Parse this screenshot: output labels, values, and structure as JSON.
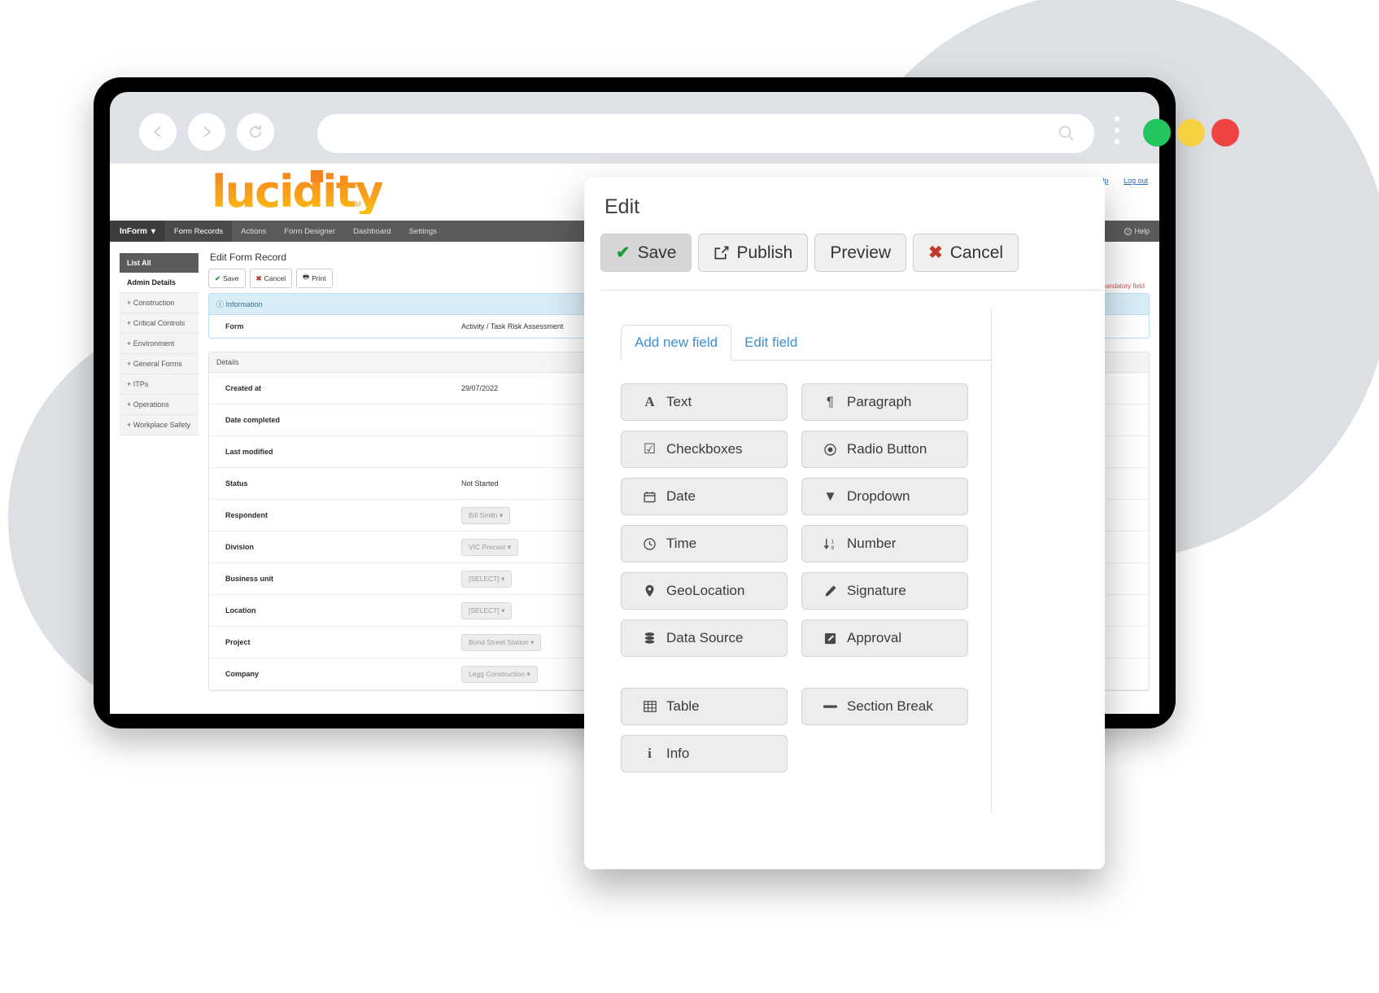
{
  "browser": {
    "back_icon": "chevron-left",
    "forward_icon": "chevron-right",
    "reload_icon": "reload",
    "omnibox_value": "",
    "omnibox_placeholder": "",
    "search_icon": "search",
    "menu_icon": "kebab-menu",
    "dots": {
      "green": "#22c55e",
      "yellow": "#f5d142",
      "red": "#ef4444"
    }
  },
  "app": {
    "logo_text": "lucidity",
    "logo_tm": "TM",
    "header_links": [
      "Help",
      "Log out"
    ],
    "navbar": {
      "brand": "InForm",
      "brand_caret": "▾",
      "items": [
        {
          "label": "Form Records",
          "active": true
        },
        {
          "label": "Actions",
          "active": false
        },
        {
          "label": "Form Designer",
          "active": false
        },
        {
          "label": "Dashboard",
          "active": false
        },
        {
          "label": "Settings",
          "active": false
        }
      ],
      "help_label": "Help",
      "help_icon": "question-circle-icon"
    },
    "sidebar": {
      "items": [
        {
          "label": "List All",
          "type": "active"
        },
        {
          "label": "Admin Details",
          "type": "plain"
        },
        {
          "label": "Construction",
          "type": "sub"
        },
        {
          "label": "Critical Controls",
          "type": "sub"
        },
        {
          "label": "Environment",
          "type": "sub"
        },
        {
          "label": "General Forms",
          "type": "sub"
        },
        {
          "label": "ITPs",
          "type": "sub"
        },
        {
          "label": "Operations",
          "type": "sub"
        },
        {
          "label": "Workplace Safety",
          "type": "sub"
        }
      ],
      "expand_glyph": "+"
    },
    "content": {
      "title": "Edit Form Record",
      "toolbar": [
        {
          "label": "Save",
          "icon": "check-icon"
        },
        {
          "label": "Cancel",
          "icon": "x-icon"
        },
        {
          "label": "Print",
          "icon": "printer-icon"
        }
      ],
      "mandatory_note": "* indicates a mandatory field",
      "information_panel": {
        "heading": "Information",
        "heading_icon": "info-circle-icon",
        "rows": [
          {
            "label": "Form",
            "value": "Activity / Task Risk Assessment"
          }
        ]
      },
      "details_panel": {
        "heading": "Details",
        "rows": [
          {
            "label": "Created at",
            "value": "29/07/2022",
            "control": "text"
          },
          {
            "label": "Date completed",
            "value": "",
            "control": "text"
          },
          {
            "label": "Last modified",
            "value": "",
            "control": "text"
          },
          {
            "label": "Status",
            "value": "Not Started",
            "control": "text"
          },
          {
            "label": "Respondent",
            "value": "Bill Smith",
            "control": "dropdown"
          },
          {
            "label": "Division",
            "value": "VIC Precast",
            "control": "dropdown"
          },
          {
            "label": "Business unit",
            "value": "[SELECT]",
            "control": "dropdown"
          },
          {
            "label": "Location",
            "value": "[SELECT]",
            "control": "dropdown"
          },
          {
            "label": "Project",
            "value": "Bond Street Station",
            "control": "dropdown"
          },
          {
            "label": "Company",
            "value": "Legg Construction",
            "control": "dropdown"
          }
        ],
        "dropdown_caret": "▾"
      }
    }
  },
  "edit_modal": {
    "title": "Edit",
    "toolbar": [
      {
        "label": "Save",
        "icon": "check-icon",
        "active": true
      },
      {
        "label": "Publish",
        "icon": "external-link-icon",
        "active": false
      },
      {
        "label": "Preview",
        "icon": "",
        "active": false
      },
      {
        "label": "Cancel",
        "icon": "x-icon",
        "active": false
      }
    ],
    "tabs": [
      {
        "label": "Add new field",
        "active": true
      },
      {
        "label": "Edit field",
        "active": false
      }
    ],
    "field_buttons": [
      {
        "label": "Text",
        "icon": "font-a-icon"
      },
      {
        "label": "Paragraph",
        "icon": "pilcrow-icon"
      },
      {
        "label": "Checkboxes",
        "icon": "checkbox-checked-icon"
      },
      {
        "label": "Radio Button",
        "icon": "radio-dot-icon"
      },
      {
        "label": "Date",
        "icon": "calendar-icon"
      },
      {
        "label": "Dropdown",
        "icon": "caret-down-icon"
      },
      {
        "label": "Time",
        "icon": "clock-icon"
      },
      {
        "label": "Number",
        "icon": "sort-numeric-icon"
      },
      {
        "label": "GeoLocation",
        "icon": "map-pin-icon"
      },
      {
        "label": "Signature",
        "icon": "pencil-icon"
      },
      {
        "label": "Data Source",
        "icon": "database-icon"
      },
      {
        "label": "Approval",
        "icon": "edit-square-icon"
      }
    ],
    "field_buttons_secondary": [
      {
        "label": "Table",
        "icon": "table-grid-icon"
      },
      {
        "label": "Section Break",
        "icon": "minus-bar-icon"
      },
      {
        "label": "Info",
        "icon": "info-i-icon"
      }
    ]
  }
}
